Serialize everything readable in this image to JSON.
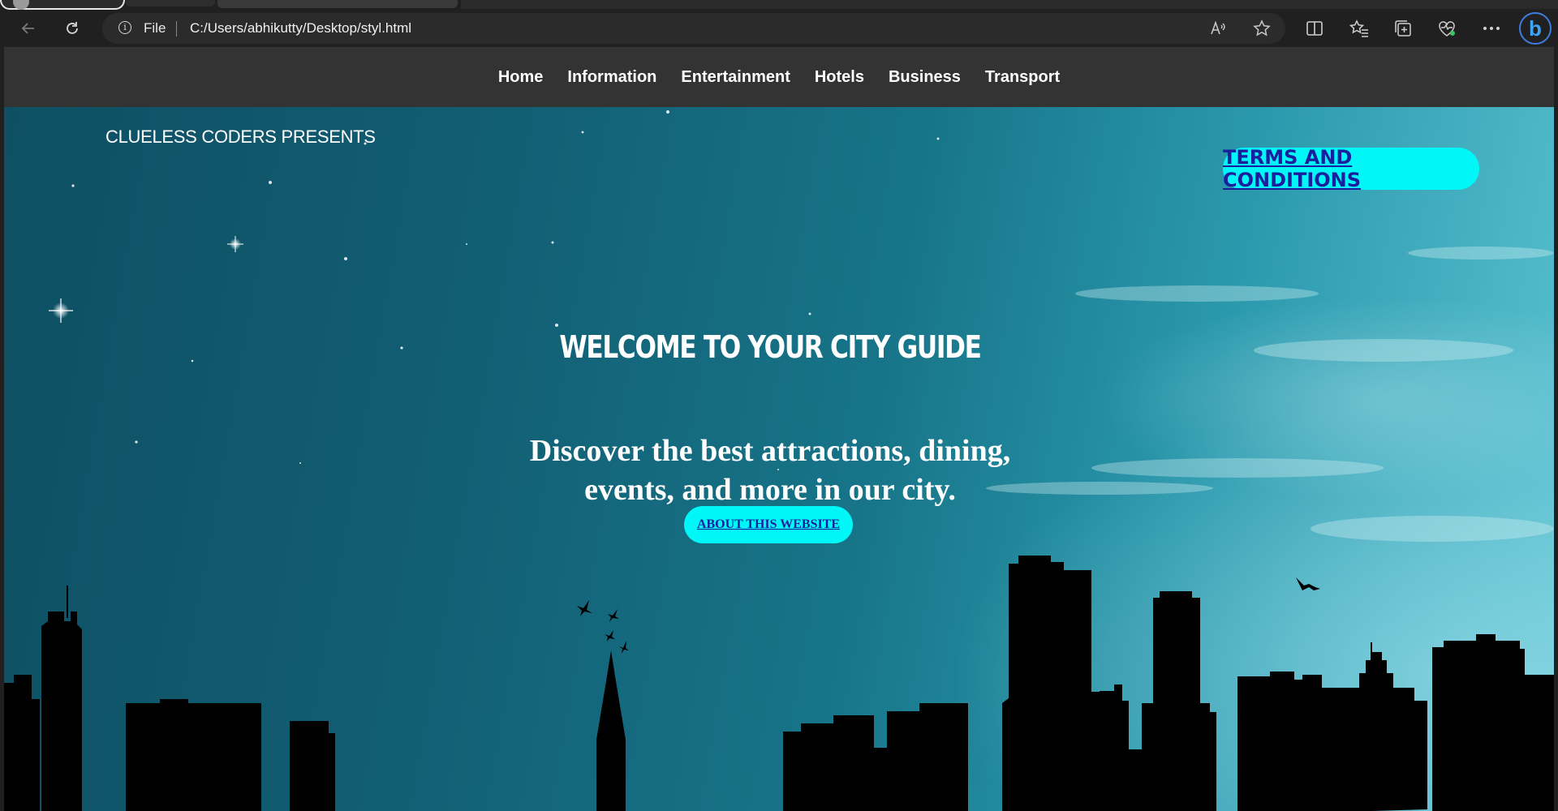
{
  "browser": {
    "address_protocol": "File",
    "address_url": "C:/Users/abhikutty/Desktop/styl.html",
    "icons": [
      "back-icon",
      "refresh-icon",
      "info-icon",
      "read-aloud-icon",
      "favorite-star-icon",
      "split-screen-icon",
      "favorites-icon",
      "collections-icon",
      "browser-essentials-icon",
      "more-icon",
      "bing-icon"
    ],
    "bing_letter": "b"
  },
  "nav": {
    "items": [
      {
        "label": "Home"
      },
      {
        "label": "Information"
      },
      {
        "label": "Entertainment"
      },
      {
        "label": "Hotels"
      },
      {
        "label": "Business"
      },
      {
        "label": "Transport"
      }
    ]
  },
  "hero": {
    "presents": "CLUELESS CODERS PRESENTS",
    "terms_label": "TERMS AND CONDITIONS",
    "welcome": "WELCOME TO YOUR CITY GUIDE",
    "tagline": "Discover the best attractions, dining, events, and more in our city.",
    "about_label": "ABOUT THIS WEBSITE"
  },
  "colors": {
    "navbar": "#333333",
    "button_bg": "#00f7f7",
    "button_text": "#1b1f9e",
    "sky_dark": "#0e4f63",
    "sky_light": "#5cc3d2"
  }
}
